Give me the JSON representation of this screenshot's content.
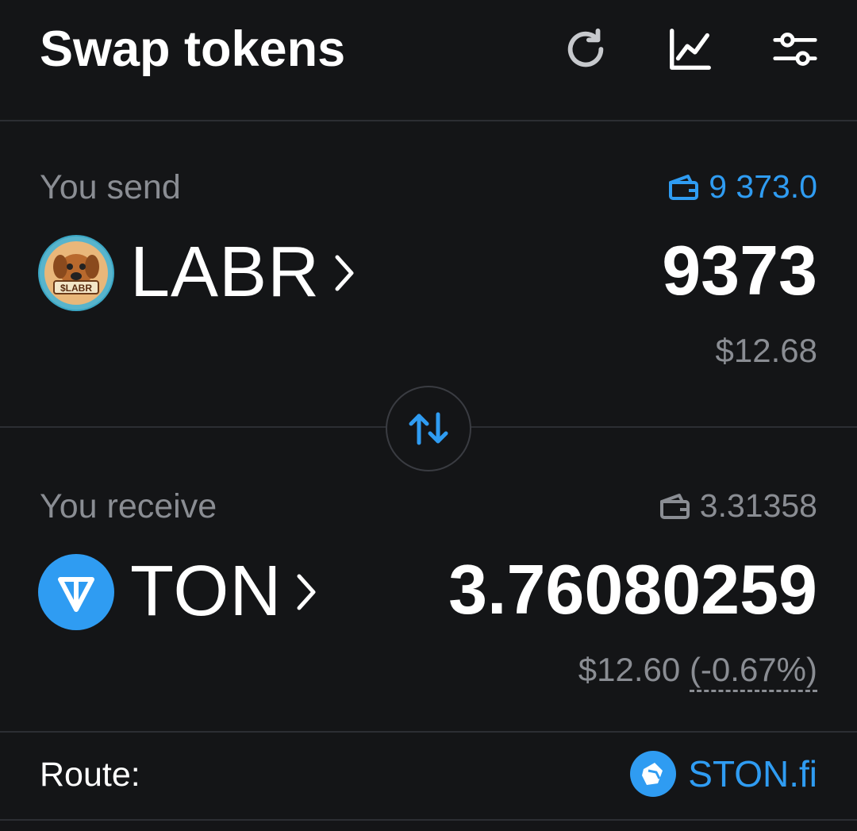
{
  "header": {
    "title": "Swap tokens",
    "icons": [
      "refresh-icon",
      "chart-icon",
      "settings-sliders-icon"
    ]
  },
  "send": {
    "label": "You send",
    "balance": "9 373.0",
    "token": "LABR",
    "token_logo_text": "$LABR",
    "amount": "9373",
    "usd": "$12.68"
  },
  "receive": {
    "label": "You receive",
    "balance": "3.31358",
    "token": "TON",
    "amount": "3.76080259",
    "usd": "$12.60",
    "price_impact": "(-0.67%)"
  },
  "route": {
    "label": "Route:",
    "provider": "STON.fi"
  },
  "colors": {
    "background": "#141517",
    "accent": "#2f9cf2",
    "muted": "#8a8d93",
    "ton": "#2f9cf2"
  }
}
